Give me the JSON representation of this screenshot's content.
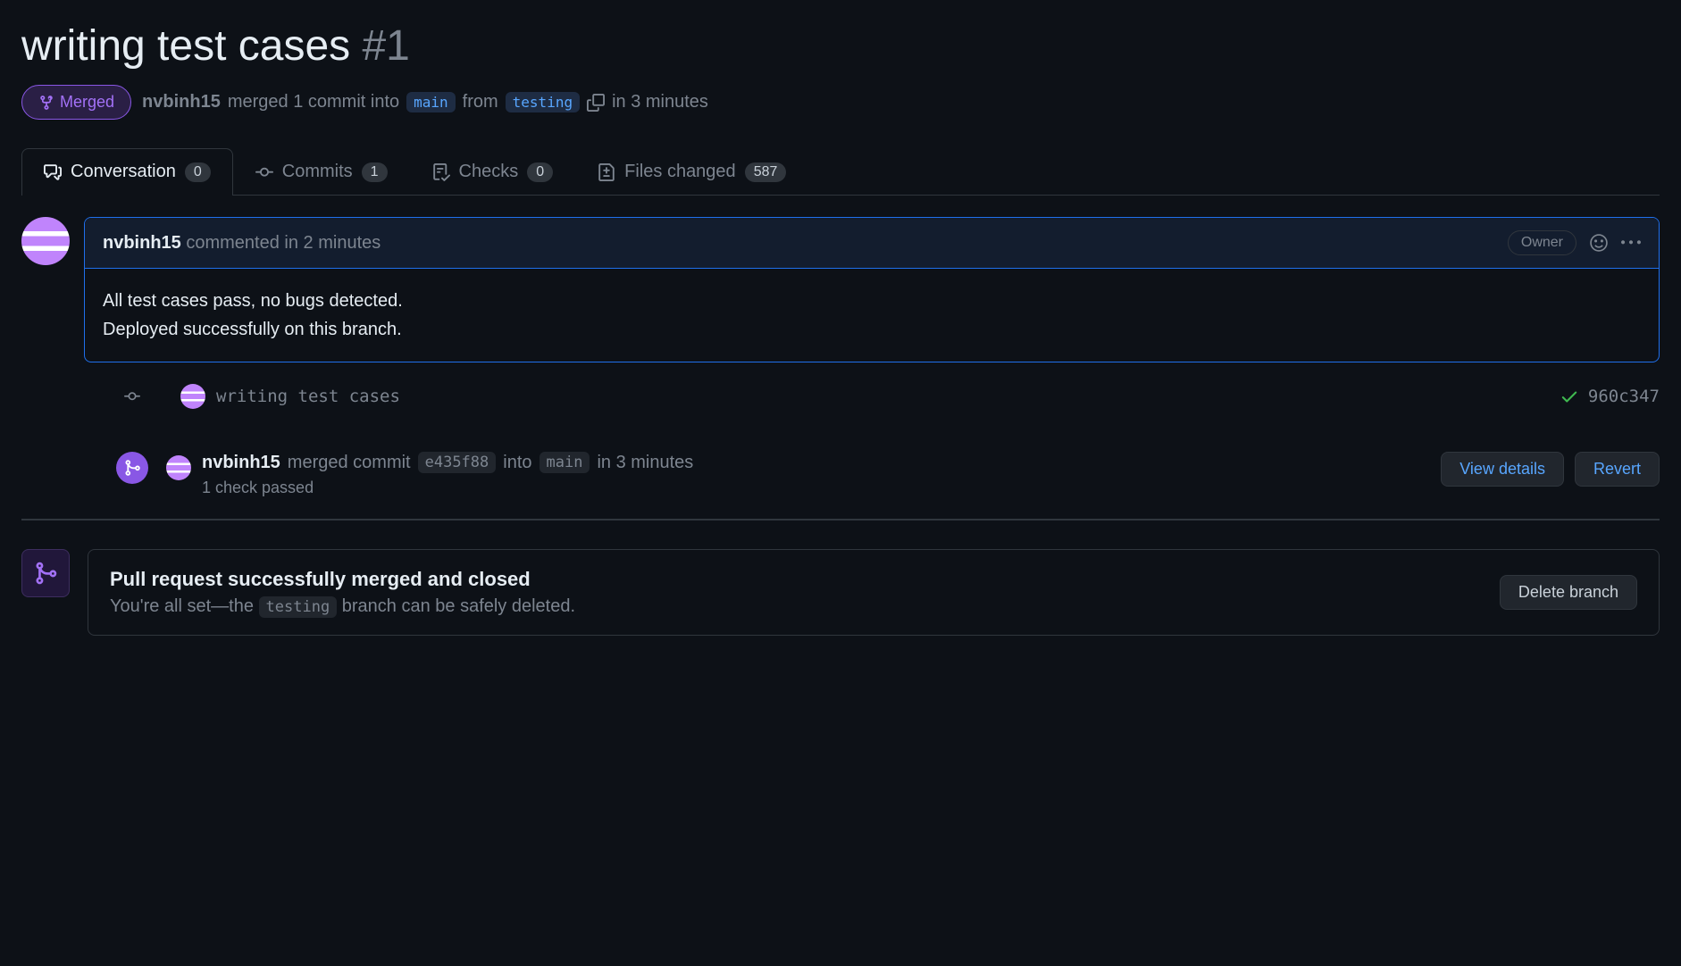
{
  "header": {
    "title": "writing test cases",
    "number": "#1"
  },
  "state": {
    "label": "Merged"
  },
  "meta": {
    "author": "nvbinh15",
    "action_prefix": "merged 1 commit into",
    "base_branch": "main",
    "from_text": "from",
    "head_branch": "testing",
    "time_text": "in 3 minutes"
  },
  "tabs": {
    "conversation": {
      "label": "Conversation",
      "count": "0"
    },
    "commits": {
      "label": "Commits",
      "count": "1"
    },
    "checks": {
      "label": "Checks",
      "count": "0"
    },
    "files": {
      "label": "Files changed",
      "count": "587"
    }
  },
  "comment": {
    "author": "nvbinh15",
    "action": "commented",
    "time": "in 2 minutes",
    "owner_label": "Owner",
    "body_line1": "All test cases pass, no bugs detected.",
    "body_line2": "Deployed successfully on this branch."
  },
  "commit": {
    "message": "writing test cases",
    "sha": "960c347"
  },
  "merge_event": {
    "author": "nvbinh15",
    "action": "merged commit",
    "commit_sha": "e435f88",
    "into_text": "into",
    "target_branch": "main",
    "time": "in 3 minutes",
    "checks": "1 check passed",
    "view_details": "View details",
    "revert": "Revert"
  },
  "merged_box": {
    "title": "Pull request successfully merged and closed",
    "sub_prefix": "You're all set—the",
    "branch": "testing",
    "sub_suffix": "branch can be safely deleted.",
    "delete_button": "Delete branch"
  }
}
